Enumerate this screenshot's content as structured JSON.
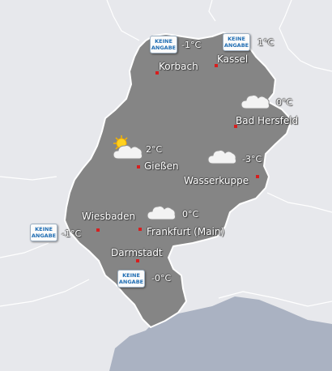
{
  "map": {
    "colors": {
      "background": "#e7e8ec",
      "hessen": "#858585",
      "border": "#ffffff",
      "water": "#aab2c2",
      "city_dot": "#d71e1e",
      "badge_text": "#1f6db3"
    },
    "no_data_label": {
      "line1": "KEINE",
      "line2": "ANGABE"
    }
  },
  "cities": [
    {
      "name": "Korbach"
    },
    {
      "name": "Kassel"
    },
    {
      "name": "Bad Hersfeld"
    },
    {
      "name": "Gießen"
    },
    {
      "name": "Wasserkuppe"
    },
    {
      "name": "Wiesbaden"
    },
    {
      "name": "Frankfurt (Main)"
    },
    {
      "name": "Darmstadt"
    }
  ],
  "stations": [
    {
      "icon": "no-data-badge",
      "temp": "-1°C"
    },
    {
      "icon": "no-data-badge",
      "temp": "1°C"
    },
    {
      "icon": "cloud-icon",
      "temp": "0°C"
    },
    {
      "icon": "partly-cloudy-icon",
      "temp": "2°C"
    },
    {
      "icon": "cloud-icon",
      "temp": "-3°C"
    },
    {
      "icon": "cloud-icon",
      "temp": "0°C"
    },
    {
      "icon": "no-data-badge",
      "temp": "-1°C"
    },
    {
      "icon": "no-data-badge",
      "temp": "-0°C"
    }
  ]
}
